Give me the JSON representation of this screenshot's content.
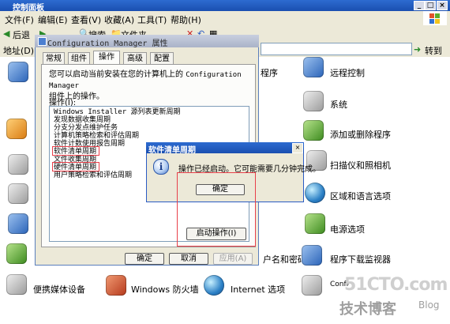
{
  "window": {
    "title": "控制面板"
  },
  "menu": [
    "文件(F)",
    "编辑(E)",
    "查看(V)",
    "收藏(A)",
    "工具(T)",
    "帮助(H)"
  ],
  "toolbar": {
    "back": "后退",
    "search": "搜索",
    "folders": "文件夹"
  },
  "address": {
    "label": "地址(D)",
    "go": "转到"
  },
  "control_panel_items": {
    "remote": "远程控制",
    "system": "系统",
    "addremove": "添加或删除程序",
    "scanner": "扫描仪和照相机",
    "region": "区域和语言选项",
    "power": "电源选项",
    "program_download": "程序下载监视器",
    "portable": "便携媒体设备",
    "firewall": "Windows 防火墙",
    "internet": "Internet 选项",
    "config_manager_short": "Configuration Manager",
    "name_password_partial": "户名和密码",
    "program_partial": "程序"
  },
  "props_dialog": {
    "title": "Configuration Manager 属性",
    "tabs": [
      "常规",
      "组件",
      "操作",
      "高级",
      "配置"
    ],
    "active_tab": "操作",
    "description_1": "您可以启动当前安装在您的计算机上的",
    "description_mono": "Configuration Manager",
    "description_2": "组件上的操作。",
    "ops_label": "操作(I):",
    "actions": [
      "Windows Installer 源列表更新周期",
      "发现数据收集周期",
      "分支分发点维护任务",
      "计算机策略检索和评估周期",
      "软件计数使用报告周期",
      "软件清单周期",
      "文件收集周期",
      "硬件清单周期",
      "用户策略检索和评估周期"
    ],
    "start_button": "启动操作(I)",
    "ok": "确定",
    "cancel": "取消",
    "apply": "应用(A)"
  },
  "message_box": {
    "title": "软件清单周期",
    "text": "操作已经启动。它可能需要几分钟完成。",
    "ok": "确定"
  },
  "watermark": {
    "site": "51CTO.com",
    "cn": "技术博客",
    "blog": "Blog"
  }
}
